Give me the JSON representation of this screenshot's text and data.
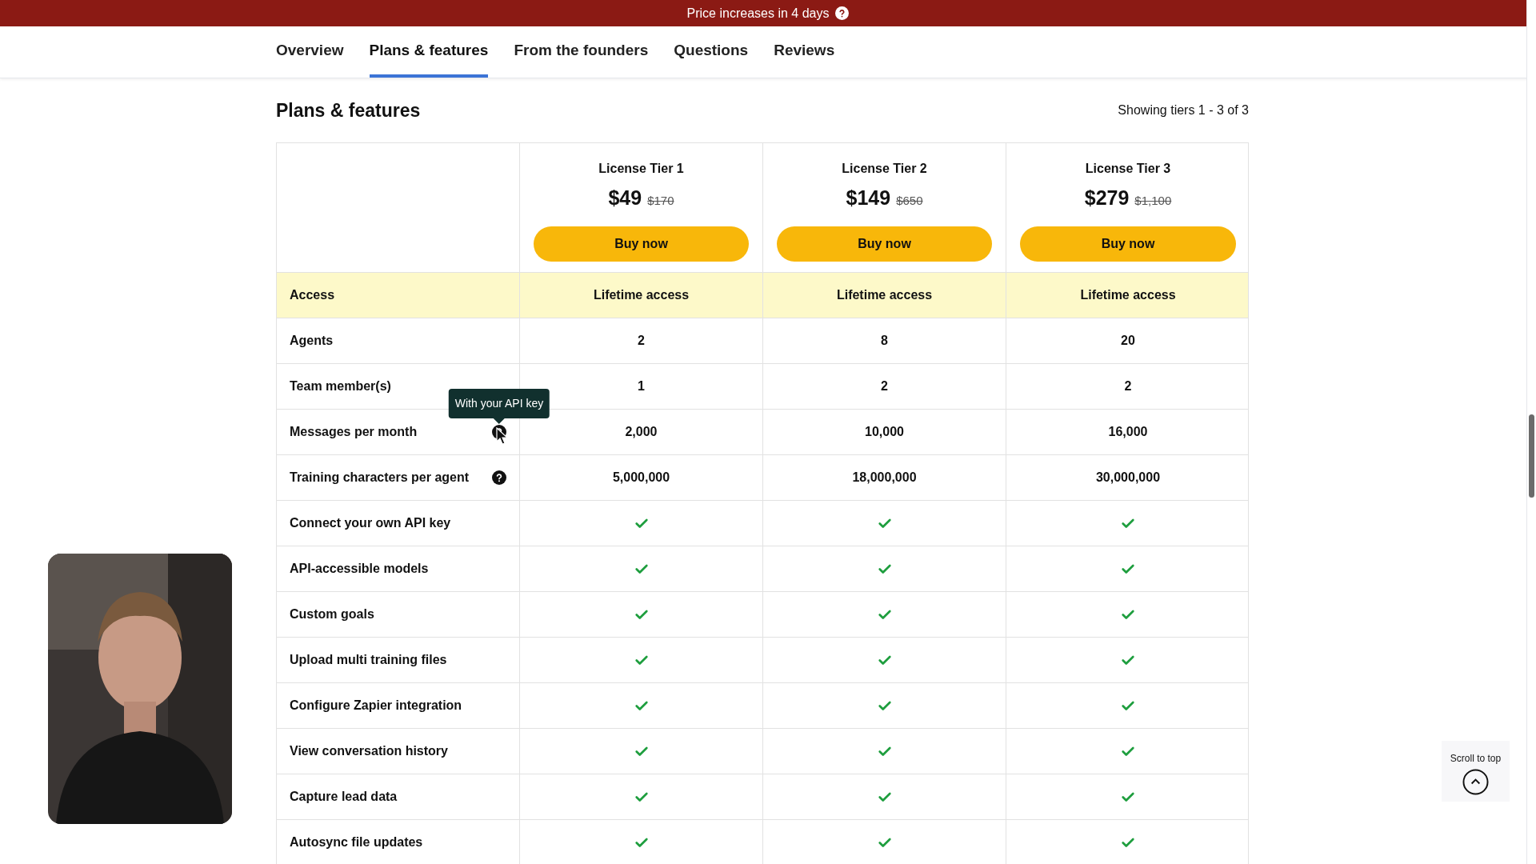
{
  "banner": {
    "text": "Price increases in 4 days"
  },
  "tabs": [
    {
      "label": "Overview",
      "selected": false
    },
    {
      "label": "Plans & features",
      "selected": true
    },
    {
      "label": "From the founders",
      "selected": false
    },
    {
      "label": "Questions",
      "selected": false
    },
    {
      "label": "Reviews",
      "selected": false
    }
  ],
  "section": {
    "title": "Plans & features",
    "count": "Showing tiers 1 - 3 of 3"
  },
  "tiers": [
    {
      "name": "License Tier 1",
      "price": "$49",
      "old_price": "$170",
      "button": "Buy now"
    },
    {
      "name": "License Tier 2",
      "price": "$149",
      "old_price": "$650",
      "button": "Buy now"
    },
    {
      "name": "License Tier 3",
      "price": "$279",
      "old_price": "$1,100",
      "button": "Buy now"
    }
  ],
  "rows": [
    {
      "label": "Access",
      "kind": "text",
      "highlighted": true,
      "values": [
        "Lifetime access",
        "Lifetime access",
        "Lifetime access"
      ]
    },
    {
      "label": "Agents",
      "kind": "text",
      "highlighted": false,
      "values": [
        "2",
        "8",
        "20"
      ]
    },
    {
      "label": "Team member(s)",
      "kind": "text",
      "highlighted": false,
      "values": [
        "1",
        "2",
        "2"
      ]
    },
    {
      "label": "Messages per month",
      "kind": "text",
      "highlighted": false,
      "help": true,
      "tooltip": "With your API key",
      "values": [
        "2,000",
        "10,000",
        "16,000"
      ]
    },
    {
      "label": "Training characters per agent",
      "kind": "text",
      "highlighted": false,
      "help": true,
      "values": [
        "5,000,000",
        "18,000,000",
        "30,000,000"
      ]
    },
    {
      "label": "Connect your own API key",
      "kind": "check",
      "highlighted": false,
      "checks": [
        true,
        true,
        true
      ]
    },
    {
      "label": "API-accessible models",
      "kind": "check",
      "highlighted": false,
      "checks": [
        true,
        true,
        true
      ]
    },
    {
      "label": "Custom goals",
      "kind": "check",
      "highlighted": false,
      "checks": [
        true,
        true,
        true
      ]
    },
    {
      "label": "Upload multi training files",
      "kind": "check",
      "highlighted": false,
      "checks": [
        true,
        true,
        true
      ]
    },
    {
      "label": "Configure Zapier integration",
      "kind": "check",
      "highlighted": false,
      "checks": [
        true,
        true,
        true
      ]
    },
    {
      "label": "View conversation history",
      "kind": "check",
      "highlighted": false,
      "checks": [
        true,
        true,
        true
      ]
    },
    {
      "label": "Capture lead data",
      "kind": "check",
      "highlighted": false,
      "checks": [
        true,
        true,
        true
      ]
    },
    {
      "label": "Autosync file updates",
      "kind": "check",
      "highlighted": false,
      "checks": [
        true,
        true,
        true
      ]
    }
  ],
  "scroll_top": {
    "label": "Scroll to top"
  }
}
